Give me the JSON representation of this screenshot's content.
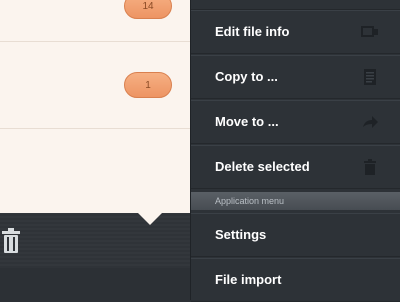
{
  "list": {
    "rows": [
      {
        "badge": "14"
      },
      {
        "badge": "1"
      },
      {
        "badge": null
      }
    ]
  },
  "menu": {
    "items": [
      {
        "label": "Edit file info",
        "icon": "edit-info-icon"
      },
      {
        "label": "Copy to ...",
        "icon": "document-icon"
      },
      {
        "label": "Move to ...",
        "icon": "arrow-icon"
      },
      {
        "label": "Delete selected",
        "icon": "trash-icon"
      }
    ],
    "section_header": "Application menu",
    "app_items": [
      {
        "label": "Settings"
      },
      {
        "label": "File import"
      }
    ]
  },
  "colors": {
    "badge": "#f0a070",
    "menu_bg": "#2d3237",
    "list_bg": "#fbf4ee"
  }
}
